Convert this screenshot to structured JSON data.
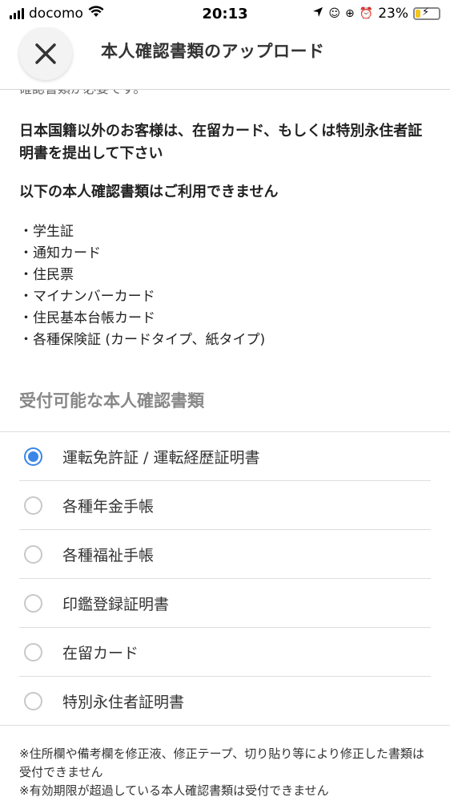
{
  "status_bar": {
    "carrier": "docomo",
    "time": "20:13",
    "battery_percent": "23%",
    "battery_level": 0.23,
    "icons": [
      "signal-icon",
      "wifi-icon",
      "location-icon",
      "alarm-icon",
      "battery-charging-icon"
    ]
  },
  "header": {
    "title": "本人確認書類のアップロード",
    "close_icon": "close-icon"
  },
  "content": {
    "clipped_text": "確認書類が必要です。",
    "notice_foreign": "日本国籍以外のお客様は、在留カード、もしくは特別永住者証明書を提出して下さい",
    "notice_unusable": "以下の本人確認書類はご利用できません",
    "unusable_documents": [
      "・学生証",
      "・通知カード",
      "・住民票",
      "・マイナンバーカード",
      "・住民基本台帳カード",
      "・各種保険証 (カードタイプ、紙タイプ)"
    ],
    "accepted_title": "受付可能な本人確認書類",
    "accepted_documents": [
      {
        "label": "運転免許証 / 運転経歴証明書",
        "selected": true
      },
      {
        "label": "各種年金手帳",
        "selected": false
      },
      {
        "label": "各種福祉手帳",
        "selected": false
      },
      {
        "label": "印鑑登録証明書",
        "selected": false
      },
      {
        "label": "在留カード",
        "selected": false
      },
      {
        "label": "特別永住者証明書",
        "selected": false
      }
    ],
    "footnotes": [
      "※住所欄や備考欄を修正液、修正テープ、切り貼り等により修正した書類は受付できません",
      "※有効期限が超過している本人確認書類は受付できません"
    ]
  },
  "colors": {
    "accent": "#3b86e8",
    "section_title": "#888888",
    "battery": "#f5c518"
  }
}
